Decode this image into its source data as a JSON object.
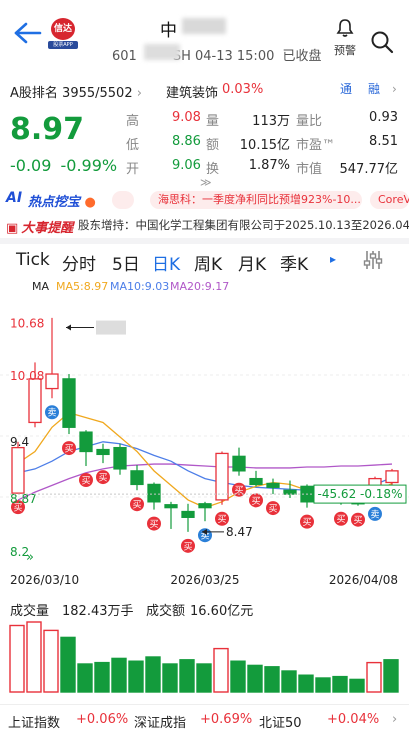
{
  "header": {
    "stock_name": "中",
    "code_prefix": "601",
    "code_suffix": "SH 04-13 15:00",
    "status": "已收盘",
    "alert_label": "预警",
    "logo_text": "信达",
    "logo_sub": "股票APP"
  },
  "quote": {
    "rank_label": "A股排名",
    "rank_value": "3955/5502",
    "sector_name": "建筑装饰",
    "sector_change": "0.03%",
    "tag_tong": "通",
    "tag_rong": "融",
    "price": "8.97",
    "change": "-0.09",
    "change_pct": "-0.99%",
    "rows": [
      {
        "l1": "高",
        "v1": "9.08",
        "l2": "量",
        "v2": "113万",
        "l3": "量比",
        "v3": "0.93"
      },
      {
        "l1": "低",
        "v1": "8.86",
        "l2": "额",
        "v2": "10.15亿",
        "l3": "市盈™",
        "v3": "8.51"
      },
      {
        "l1": "开",
        "v1": "9.06",
        "l2": "换",
        "v2": "1.87%",
        "l3": "市值",
        "v3": "547.77亿"
      }
    ],
    "expand_arrow": "≫"
  },
  "ticker": {
    "ai_label": "AI",
    "hot_label": "热点挖宝",
    "news": [
      "",
      "海思科：一季度净利同比预增923%-10...",
      "CoreV"
    ]
  },
  "event": {
    "badge": "大事提醒",
    "text": "股东增持：中国化学工程集团有限公司于2025.10.13至2026.04.0..."
  },
  "tabs": {
    "items": [
      "Tick",
      "分时",
      "5日",
      "日K",
      "周K",
      "月K",
      "季K"
    ],
    "active": "日K",
    "more": "▸"
  },
  "ma": {
    "label": "MA",
    "ma5": "MA5:8.97",
    "ma10": "MA10:9.03",
    "ma20": "MA20:9.17",
    "colors": {
      "ma5": "#f0a81e",
      "ma10": "#4d7ee8",
      "ma20": "#b058c8"
    }
  },
  "chart_data": {
    "type": "candlestick",
    "y_labels": [
      "10.68",
      "10.08",
      "9.4",
      "8.87",
      "8.2"
    ],
    "high_label": "10.68",
    "low_label": "8.47",
    "x_labels": [
      "2026/03/10",
      "2026/03/25",
      "2026/04/08"
    ],
    "hover_change": "-45.62",
    "hover_pct": "-0.18%",
    "candles": [
      {
        "o": 8.87,
        "c": 9.34,
        "h": 9.4,
        "l": 8.87
      },
      {
        "o": 9.6,
        "c": 10.05,
        "h": 10.22,
        "l": 9.55
      },
      {
        "o": 9.95,
        "c": 10.1,
        "h": 10.68,
        "l": 9.85
      },
      {
        "o": 10.05,
        "c": 9.55,
        "h": 10.1,
        "l": 9.48
      },
      {
        "o": 9.5,
        "c": 9.3,
        "h": 9.52,
        "l": 9.15
      },
      {
        "o": 9.32,
        "c": 9.27,
        "h": 9.38,
        "l": 9.18
      },
      {
        "o": 9.34,
        "c": 9.12,
        "h": 9.38,
        "l": 9.06
      },
      {
        "o": 9.1,
        "c": 8.96,
        "h": 9.16,
        "l": 8.9
      },
      {
        "o": 8.96,
        "c": 8.78,
        "h": 8.98,
        "l": 8.7
      },
      {
        "o": 8.75,
        "c": 8.72,
        "h": 8.78,
        "l": 8.5
      },
      {
        "o": 8.68,
        "c": 8.62,
        "h": 8.76,
        "l": 8.47
      },
      {
        "o": 8.76,
        "c": 8.72,
        "h": 8.78,
        "l": 8.58
      },
      {
        "o": 8.8,
        "c": 9.28,
        "h": 9.3,
        "l": 8.75
      },
      {
        "o": 9.25,
        "c": 9.1,
        "h": 9.34,
        "l": 9.05
      },
      {
        "o": 9.02,
        "c": 8.96,
        "h": 9.1,
        "l": 8.94
      },
      {
        "o": 8.97,
        "c": 8.93,
        "h": 9.02,
        "l": 8.86
      },
      {
        "o": 8.9,
        "c": 8.86,
        "h": 9.0,
        "l": 8.82
      },
      {
        "o": 8.94,
        "c": 8.78,
        "h": 8.96,
        "l": 8.72
      },
      {
        "o": 8.9,
        "c": 8.88,
        "h": 8.92,
        "l": 8.82
      },
      {
        "o": 8.86,
        "c": 8.84,
        "h": 8.9,
        "l": 8.75
      },
      {
        "o": 8.86,
        "c": 8.76,
        "h": 8.9,
        "l": 8.74
      },
      {
        "o": 8.82,
        "c": 9.02,
        "h": 9.04,
        "l": 8.8
      },
      {
        "o": 8.98,
        "c": 9.1,
        "h": 9.12,
        "l": 8.94
      }
    ],
    "ma5": [
      9.18,
      9.3,
      9.55,
      9.7,
      9.65,
      9.6,
      9.45,
      9.3,
      9.1,
      8.95,
      8.8,
      8.72,
      8.78,
      8.88,
      8.94,
      8.98,
      8.96,
      8.9,
      8.86,
      8.84,
      8.82,
      8.88,
      8.97
    ],
    "ma10": [
      9.08,
      9.12,
      9.2,
      9.3,
      9.35,
      9.4,
      9.38,
      9.33,
      9.26,
      9.2,
      9.1,
      9.02,
      8.98,
      8.95,
      8.93,
      8.92,
      8.91,
      8.9,
      8.89,
      8.9,
      8.92,
      8.96,
      9.03
    ],
    "ma20": [
      8.8,
      8.88,
      8.95,
      9.02,
      9.08,
      9.12,
      9.15,
      9.16,
      9.17,
      9.17,
      9.16,
      9.15,
      9.14,
      9.14,
      9.13,
      9.13,
      9.13,
      9.14,
      9.14,
      9.15,
      9.15,
      9.16,
      9.17
    ],
    "signals": [
      {
        "i": 0,
        "t": "买",
        "pos": "below"
      },
      {
        "i": 2,
        "t": "卖",
        "pos": "below"
      },
      {
        "i": 3,
        "t": "买",
        "pos": "below"
      },
      {
        "i": 4,
        "t": "买",
        "pos": "below"
      },
      {
        "i": 5,
        "t": "买",
        "pos": "below"
      },
      {
        "i": 7,
        "t": "买",
        "pos": "below"
      },
      {
        "i": 8,
        "t": "买",
        "pos": "below"
      },
      {
        "i": 10,
        "t": "买",
        "pos": "below"
      },
      {
        "i": 11,
        "t": "卖",
        "pos": "below"
      },
      {
        "i": 12,
        "t": "买",
        "pos": "below"
      },
      {
        "i": 13,
        "t": "买",
        "pos": "below"
      },
      {
        "i": 14,
        "t": "买",
        "pos": "below"
      },
      {
        "i": 15,
        "t": "买",
        "pos": "below"
      },
      {
        "i": 17,
        "t": "买",
        "pos": "below"
      },
      {
        "i": 19,
        "t": "买",
        "pos": "below"
      },
      {
        "i": 20,
        "t": "买",
        "pos": "below"
      },
      {
        "i": 21,
        "t": "卖",
        "pos": "below"
      }
    ],
    "ylim": [
      8.2,
      10.72
    ]
  },
  "volume": {
    "label": "成交量",
    "value": "182.43万手",
    "amount_label": "成交额",
    "amount_value": "16.60亿元",
    "bars": [
      {
        "v": 95,
        "up": true
      },
      {
        "v": 100,
        "up": true
      },
      {
        "v": 88,
        "up": true
      },
      {
        "v": 78,
        "up": false
      },
      {
        "v": 40,
        "up": false
      },
      {
        "v": 42,
        "up": false
      },
      {
        "v": 48,
        "up": false
      },
      {
        "v": 44,
        "up": false
      },
      {
        "v": 50,
        "up": false
      },
      {
        "v": 40,
        "up": false
      },
      {
        "v": 46,
        "up": false
      },
      {
        "v": 40,
        "up": false
      },
      {
        "v": 62,
        "up": true
      },
      {
        "v": 44,
        "up": false
      },
      {
        "v": 38,
        "up": false
      },
      {
        "v": 36,
        "up": false
      },
      {
        "v": 30,
        "up": false
      },
      {
        "v": 24,
        "up": false
      },
      {
        "v": 20,
        "up": false
      },
      {
        "v": 22,
        "up": false
      },
      {
        "v": 18,
        "up": false
      },
      {
        "v": 42,
        "up": true
      },
      {
        "v": 46,
        "up": false
      }
    ]
  },
  "indices": [
    {
      "name": "上证指数",
      "chg": "+0.06%"
    },
    {
      "name": "深证成指",
      "chg": "+0.69%"
    },
    {
      "name": "北证50",
      "chg": "+0.04%"
    }
  ]
}
